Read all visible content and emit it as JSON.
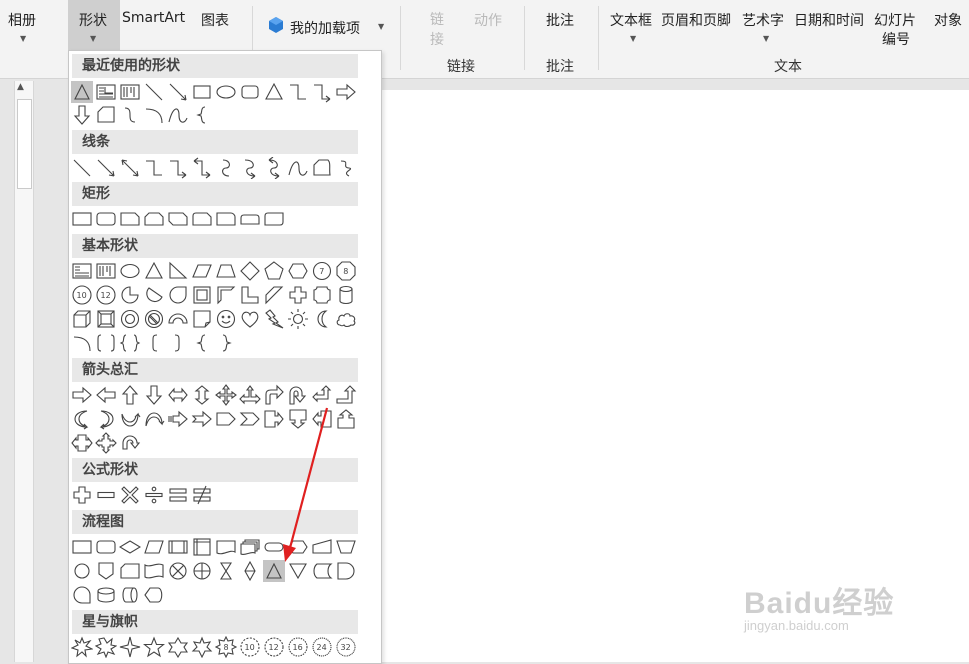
{
  "ribbon": {
    "album": "相册",
    "shapes": "形状",
    "smartart": "SmartArt",
    "chart": "图表",
    "addins": "我的加载项",
    "link": "链\n接",
    "action": "动作",
    "comment": "批注",
    "textbox": "文本框",
    "header_footer": "页眉和页脚",
    "wordart": "艺术字",
    "datetime": "日期和时间",
    "slide_number_1": "幻灯片",
    "slide_number_2": "编号",
    "object": "对象",
    "group_links": "链接",
    "group_comments": "批注",
    "group_text": "文本"
  },
  "gallery": {
    "sections": {
      "recent": "最近使用的形状",
      "lines": "线条",
      "rectangles": "矩形",
      "basic": "基本形状",
      "arrows": "箭头总汇",
      "equation": "公式形状",
      "flowchart": "流程图",
      "stars": "星与旗帜"
    },
    "badge_labels": {
      "n7": "7",
      "n8": "8",
      "n10": "10",
      "n12": "12",
      "s8": "8",
      "s10": "10",
      "s12": "12",
      "s16": "16",
      "s24": "24",
      "s32": "32"
    }
  },
  "watermark": {
    "main": "Baidu经验",
    "sub": "jingyan.baidu.com"
  },
  "colors": {
    "annotation_arrow": "#e02020",
    "selected_shape_bg": "#c4c4c4",
    "section_header_bg": "#e8e8e8"
  }
}
